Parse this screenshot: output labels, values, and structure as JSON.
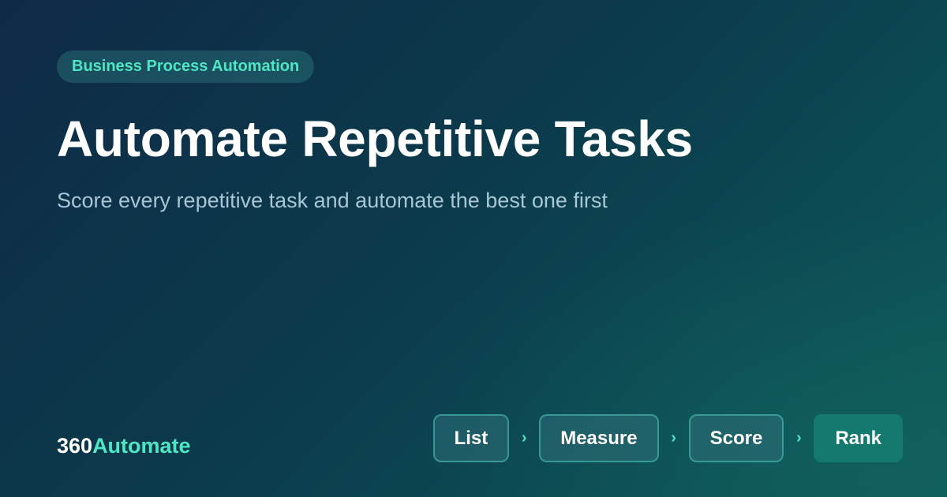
{
  "badge": "Business Process Automation",
  "title": "Automate Repetitive Tasks",
  "subtitle": "Score every repetitive task and automate the best one first",
  "brand": {
    "part1": "360",
    "part2": "Automate"
  },
  "steps": [
    {
      "label": "List"
    },
    {
      "label": "Measure"
    },
    {
      "label": "Score"
    },
    {
      "label": "Rank",
      "active": true
    }
  ],
  "separator_icon": "chevron-right-icon",
  "colors": {
    "accent": "#4ee6c4",
    "active_step": "#147a70",
    "title": "#ffffff",
    "subtitle": "#a9c6d4"
  }
}
